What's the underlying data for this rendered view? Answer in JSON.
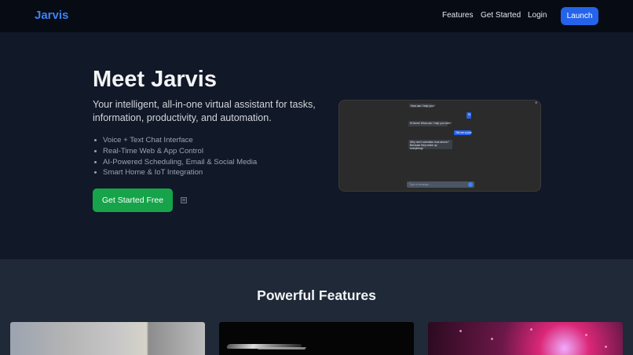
{
  "header": {
    "brand": "Jarvis",
    "nav": [
      "Features",
      "Get Started",
      "Login"
    ],
    "launch_label": "Launch",
    "accent": "#3b82f6"
  },
  "hero": {
    "title": "Meet Jarvis",
    "subtitle": "Your intelligent, all-in-one virtual assistant for tasks, information, productivity, and automation.",
    "features": [
      "Voice + Text Chat Interface",
      "Real-Time Web & App Control",
      "AI-Powered Scheduling, Email & Social Media",
      "Smart Home & IoT Integration"
    ],
    "cta_label": "Get Started Free",
    "cta_color": "#16a34a"
  },
  "chat_preview": {
    "messages": [
      {
        "side": "left",
        "text": "How can I help you?"
      },
      {
        "side": "right",
        "text": "Hi"
      },
      {
        "side": "left",
        "text": "Hi there! What can I help you with?"
      },
      {
        "side": "right",
        "text": "Tell me a joke"
      },
      {
        "side": "left",
        "text": "Why don't scientists trust atoms? Because they make up everything!"
      }
    ],
    "input_placeholder": "Type a message..."
  },
  "features_section": {
    "title": "Powerful Features"
  }
}
